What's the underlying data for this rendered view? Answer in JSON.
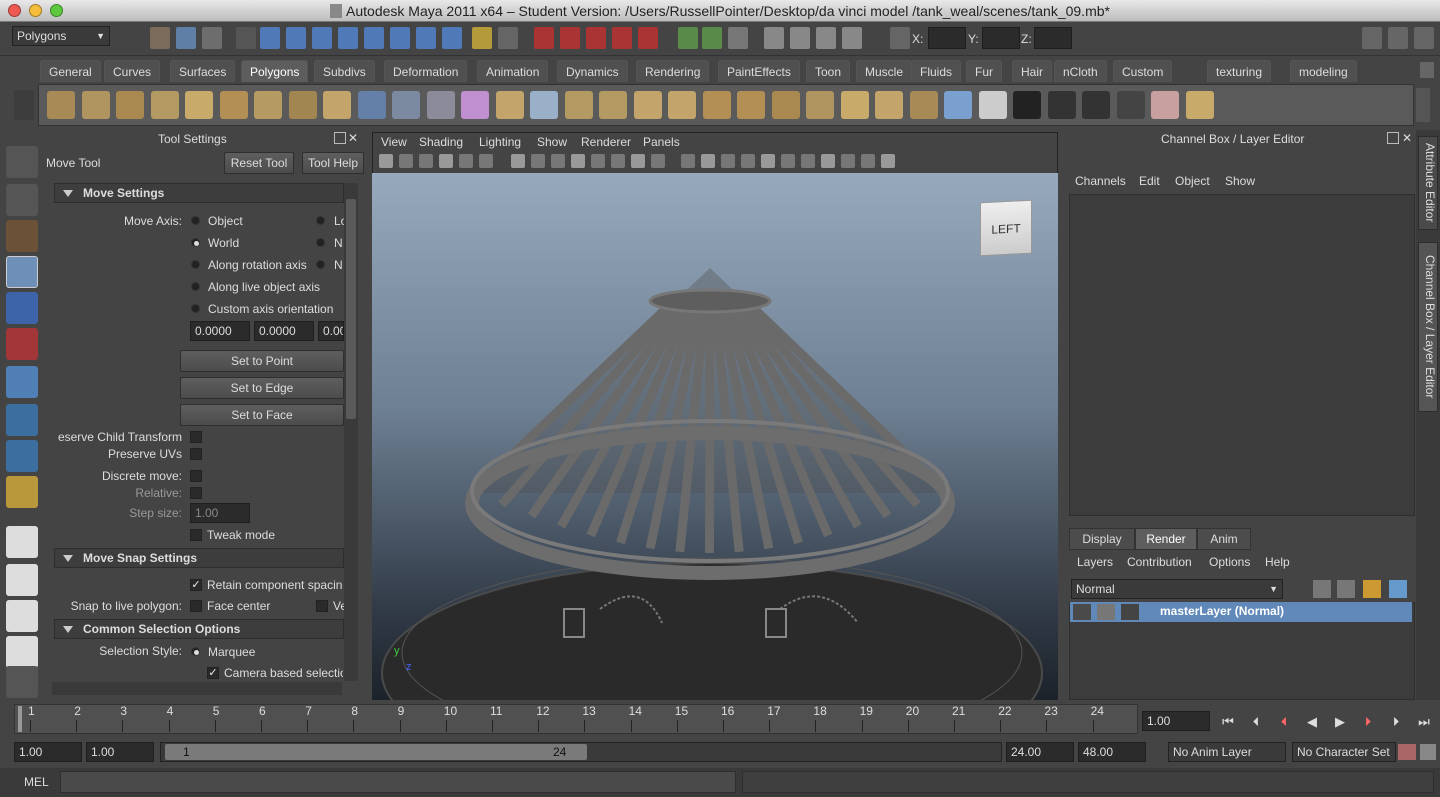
{
  "window": {
    "title": "Autodesk Maya 2011 x64 – Student Version: /Users/RussellPointer/Desktop/da vinci model /tank_weal/scenes/tank_09.mb*"
  },
  "status_line": {
    "menu_set": "Polygons",
    "x_label": "X:",
    "y_label": "Y:",
    "z_label": "Z:"
  },
  "shelf_tabs": [
    "General",
    "Curves",
    "Surfaces",
    "Polygons",
    "Subdivs",
    "Deformation",
    "Animation",
    "Dynamics",
    "Rendering",
    "PaintEffects",
    "Toon",
    "Muscle",
    "Fluids",
    "Fur",
    "Hair",
    "nCloth",
    "Custom",
    "texturing",
    "modeling"
  ],
  "active_shelf_tab": "Polygons",
  "tool_settings": {
    "panel_title": "Tool Settings",
    "tool_name": "Move Tool",
    "reset_label": "Reset Tool",
    "help_label": "Tool Help",
    "move_settings": {
      "header": "Move Settings",
      "axis_label": "Move Axis:",
      "options": [
        "Object",
        "World",
        "Along rotation axis",
        "Along live object axis",
        "Custom axis orientation"
      ],
      "col2_options": [
        "Lo",
        "N",
        "N"
      ],
      "values": [
        "0.0000",
        "0.0000",
        "0.00"
      ],
      "set_to_point": "Set to Point",
      "set_to_edge": "Set to Edge",
      "set_to_face": "Set to Face",
      "preserve_child": "eserve Child Transform",
      "preserve_uvs": "Preserve UVs",
      "discrete_move": "Discrete move:",
      "relative": "Relative:",
      "step_size_label": "Step size:",
      "step_size": "1.00",
      "tweak_mode": "Tweak mode"
    },
    "snap": {
      "header": "Move Snap Settings",
      "retain": "Retain component spacin",
      "snap_live_label": "Snap to live polygon:",
      "face_center": "Face center",
      "ve": "Ve"
    },
    "selection": {
      "header": "Common Selection Options",
      "style_label": "Selection Style:",
      "marquee": "Marquee",
      "camera_based": "Camera based selectio"
    }
  },
  "viewport": {
    "menus": [
      "View",
      "Shading",
      "Lighting",
      "Show",
      "Renderer",
      "Panels"
    ],
    "view_cube": "LEFT",
    "axis_y": "y",
    "axis_z": "z"
  },
  "channel_box": {
    "title": "Channel Box / Layer Editor",
    "menus": [
      "Channels",
      "Edit",
      "Object",
      "Show"
    ],
    "layer_tabs": [
      "Display",
      "Render",
      "Anim"
    ],
    "active_layer_tab": "Render",
    "layer_menus": [
      "Layers",
      "Contribution",
      "Options",
      "Help"
    ],
    "blend_mode": "Normal",
    "layers": [
      {
        "name": "masterLayer (Normal)"
      }
    ]
  },
  "side_tabs": [
    "Attribute Editor",
    "Channel Box / Layer Editor"
  ],
  "time_slider": {
    "ticks": [
      "1",
      "2",
      "3",
      "4",
      "5",
      "6",
      "7",
      "8",
      "9",
      "10",
      "11",
      "12",
      "13",
      "14",
      "15",
      "16",
      "17",
      "18",
      "19",
      "20",
      "21",
      "22",
      "23",
      "24"
    ],
    "current_frame": "1.00"
  },
  "range_slider": {
    "start": "1.00",
    "inner_start": "1.00",
    "slider_start": "1",
    "slider_end": "24",
    "end": "24.00",
    "outer_end": "48.00",
    "anim_layer": "No Anim Layer",
    "character_set": "No Character Set"
  },
  "command_line": {
    "label": "MEL"
  }
}
